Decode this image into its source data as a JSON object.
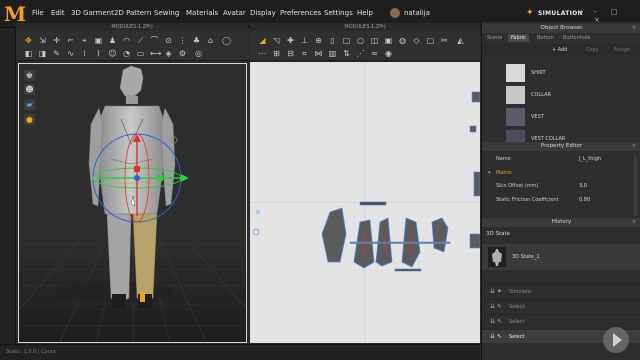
{
  "app": {
    "logo": "M",
    "menu": [
      "File",
      "Edit",
      "3D Garment",
      "2D Pattern",
      "Sewing",
      "Materials",
      "Avatar",
      "Display",
      "Preferences",
      "Settings",
      "Help"
    ],
    "user": "natalija",
    "mode": "SIMULATION",
    "window_controls": "- □ ×"
  },
  "window_3d": {
    "title": "MODULES-1.ZPrj"
  },
  "window_2d": {
    "title": "MODULES-1.ZPrj"
  },
  "status": {
    "text": "Static: 1.0.0  | Count"
  },
  "object_browser": {
    "title": "Object Browser",
    "tabs": [
      "Scene",
      "Fabric",
      "Button",
      "Buttonhole"
    ],
    "active_tab": "Fabric",
    "actions": [
      "+ Add",
      "Copy",
      "Assign"
    ],
    "items": [
      {
        "label": "SHIRT",
        "color": "#d9d9d9"
      },
      {
        "label": "COLLAR",
        "color": "#c8c8c8"
      },
      {
        "label": "VEST",
        "color": "#5c5a68"
      },
      {
        "label": "VEST COLLAR",
        "color": "#4e4c5a"
      }
    ]
  },
  "property_editor": {
    "title": "Property Editor",
    "name_label": "Name",
    "name_value": "J_L_thigh",
    "section": "Matrix",
    "rows": [
      {
        "label": "Skin Offset (mm)",
        "value": "3.0"
      },
      {
        "label": "Static Friction Coefficient",
        "value": "0.80"
      }
    ]
  },
  "history": {
    "title": "History",
    "header": "3D State",
    "state_label": "3D State_1",
    "rows": [
      {
        "label": "Simulate",
        "active": false
      },
      {
        "label": "Select",
        "active": false
      },
      {
        "label": "Select",
        "active": false
      },
      {
        "label": "Select",
        "active": true
      }
    ]
  },
  "colors": {
    "accent": "#f2a516",
    "menu_bg": "#1e1e1e",
    "panel_bg": "#2e2e2e",
    "pattern_fill": "#5b5b5b",
    "pattern_outline": "#4f86d9",
    "gizmo_x": "#e03030",
    "gizmo_y": "#2fcc3c",
    "gizmo_z": "#2f5fd8",
    "grid_2d": "#d2d2d2"
  }
}
